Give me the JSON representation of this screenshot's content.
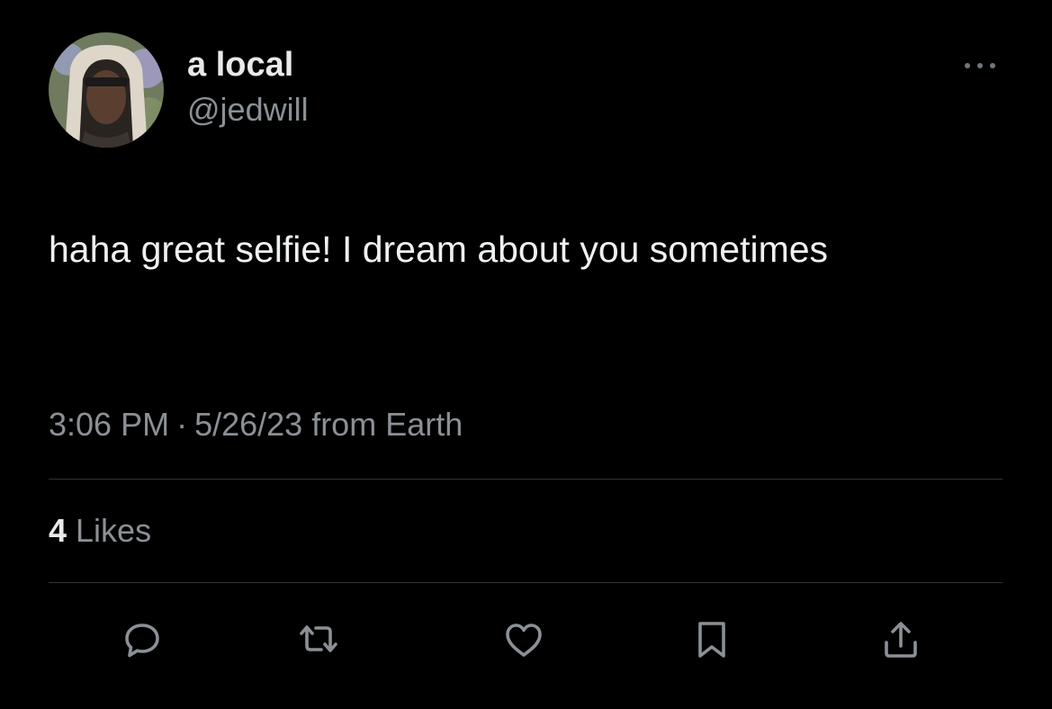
{
  "user": {
    "display_name": "a local",
    "handle": "@jedwill"
  },
  "tweet": {
    "text": "haha great selfie! I dream about you sometimes",
    "time": "3:06 PM",
    "separator": "·",
    "date_source": "5/26/23 from Earth"
  },
  "engagement": {
    "likes_count": "4",
    "likes_label": "Likes"
  },
  "actions": [
    {
      "icon": "reply-icon"
    },
    {
      "icon": "retweet-icon"
    },
    {
      "icon": "heart-icon"
    },
    {
      "icon": "bookmark-icon"
    },
    {
      "icon": "share-icon"
    }
  ],
  "colors": {
    "background": "#000000",
    "primary_text": "#e7e9ea",
    "secondary_text": "#8b9096",
    "divider": "#2f3336"
  }
}
